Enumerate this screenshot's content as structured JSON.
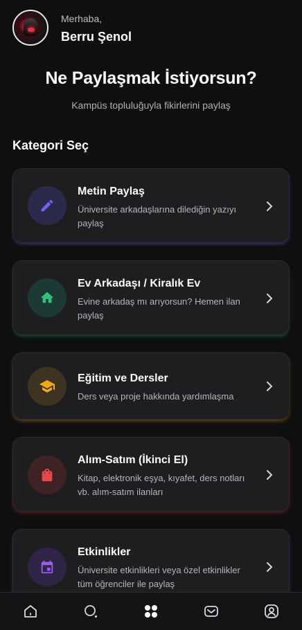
{
  "header": {
    "greeting": "Merhaba,",
    "user_name": "Berru Şenol"
  },
  "hero": {
    "title": "Ne Paylaşmak İstiyorsun?",
    "subtitle": "Kampüs topluluğuyla fikirlerini paylaş"
  },
  "section_title": "Kategori Seç",
  "categories": [
    {
      "title": "Metin Paylaş",
      "description": "Üniversite arkadaşlarına dilediğin yazıyı paylaş",
      "icon": "pencil-icon",
      "color": "#6f63f0"
    },
    {
      "title": "Ev Arkadaşı / Kiralık Ev",
      "description": "Evine arkadaş mı arıyorsun? Hemen ilan paylaş",
      "icon": "home-icon",
      "color": "#2ec27e"
    },
    {
      "title": "Eğitim ve Dersler",
      "description": "Ders veya proje hakkında yardımlaşma",
      "icon": "graduation-cap-icon",
      "color": "#f0a81c"
    },
    {
      "title": "Alım-Satım (İkinci El)",
      "description": "Kitap, elektronik eşya, kıyafet, ders notları vb. alım-satım ilanları",
      "icon": "shopping-bag-icon",
      "color": "#e5484d"
    },
    {
      "title": "Etkinlikler",
      "description": "Üniversite etkinlikleri veya özel etkinlikler tüm öğrenciler ile paylaş",
      "icon": "calendar-icon",
      "color": "#9b5cf0"
    }
  ],
  "bottom_nav": [
    "home-icon",
    "search-icon",
    "grid-icon",
    "inbox-icon",
    "profile-icon"
  ]
}
